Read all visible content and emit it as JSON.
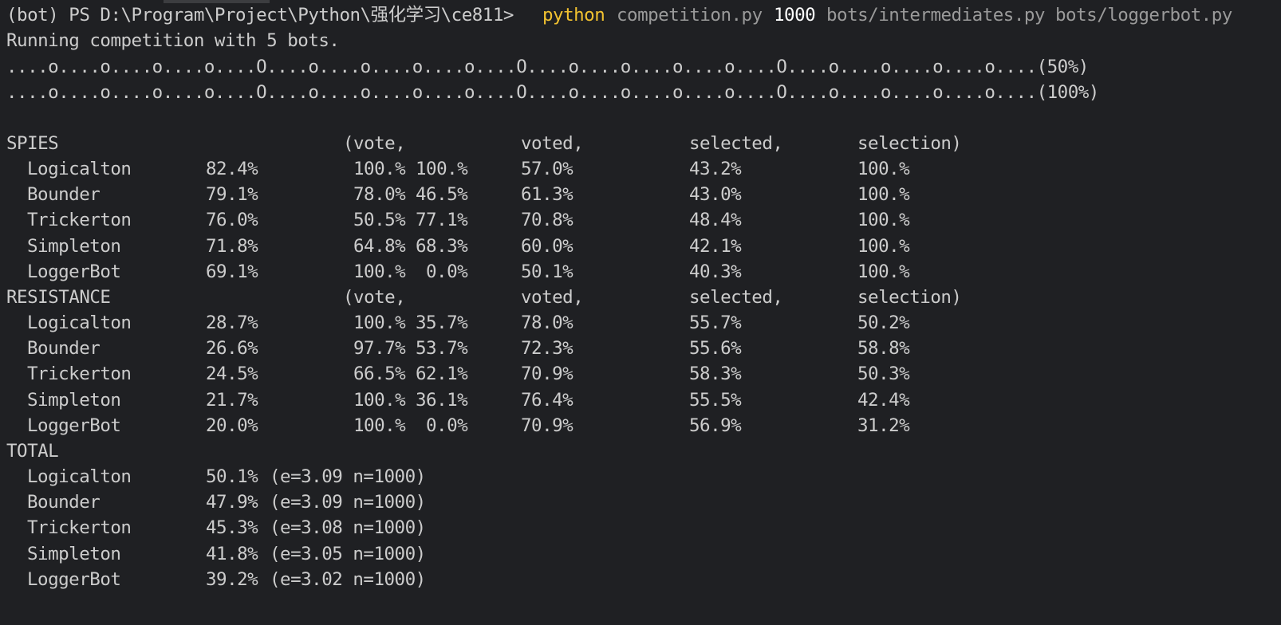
{
  "colors": {
    "background": "#1f2023",
    "text": "#cccccc",
    "command": "#f2c230",
    "argument": "#9a9a9a",
    "number": "#ffffff"
  },
  "prompt": {
    "text": "(bot) PS D:\\Program\\Project\\Python\\强化学习\\ce811>",
    "command": "python",
    "script": "competition.py",
    "games": "1000",
    "bots": "bots/intermediates.py bots/loggerbot.py"
  },
  "status": "Running competition with 5 bots.",
  "progress": [
    "....o....o....o....o....O....o....o....o....o....O....o....o....o....o....O....o....o....o....o....(50%)",
    "....o....o....o....o....O....o....o....o....o....O....o....o....o....o....O....o....o....o....o....(100%)"
  ],
  "headers": {
    "vote": "(vote,",
    "voted": "voted,",
    "selected": "selected,",
    "selection": "selection)"
  },
  "spies": {
    "title": "SPIES",
    "rows": [
      {
        "name": "Logicalton",
        "win": "82.4%",
        "vote1": "100.%",
        "vote2": "100.%",
        "voted": "57.0%",
        "selected": "43.2%",
        "selection": "100.%"
      },
      {
        "name": "Bounder",
        "win": "79.1%",
        "vote1": "78.0%",
        "vote2": "46.5%",
        "voted": "61.3%",
        "selected": "43.0%",
        "selection": "100.%"
      },
      {
        "name": "Trickerton",
        "win": "76.0%",
        "vote1": "50.5%",
        "vote2": "77.1%",
        "voted": "70.8%",
        "selected": "48.4%",
        "selection": "100.%"
      },
      {
        "name": "Simpleton",
        "win": "71.8%",
        "vote1": "64.8%",
        "vote2": "68.3%",
        "voted": "60.0%",
        "selected": "42.1%",
        "selection": "100.%"
      },
      {
        "name": "LoggerBot",
        "win": "69.1%",
        "vote1": "100.%",
        "vote2": "0.0%",
        "voted": "50.1%",
        "selected": "40.3%",
        "selection": "100.%"
      }
    ]
  },
  "resistance": {
    "title": "RESISTANCE",
    "rows": [
      {
        "name": "Logicalton",
        "win": "28.7%",
        "vote1": "100.%",
        "vote2": "35.7%",
        "voted": "78.0%",
        "selected": "55.7%",
        "selection": "50.2%"
      },
      {
        "name": "Bounder",
        "win": "26.6%",
        "vote1": "97.7%",
        "vote2": "53.7%",
        "voted": "72.3%",
        "selected": "55.6%",
        "selection": "58.8%"
      },
      {
        "name": "Trickerton",
        "win": "24.5%",
        "vote1": "66.5%",
        "vote2": "62.1%",
        "voted": "70.9%",
        "selected": "58.3%",
        "selection": "50.3%"
      },
      {
        "name": "Simpleton",
        "win": "21.7%",
        "vote1": "100.%",
        "vote2": "36.1%",
        "voted": "76.4%",
        "selected": "55.5%",
        "selection": "42.4%"
      },
      {
        "name": "LoggerBot",
        "win": "20.0%",
        "vote1": "100.%",
        "vote2": "0.0%",
        "voted": "70.9%",
        "selected": "56.9%",
        "selection": "31.2%"
      }
    ]
  },
  "total": {
    "title": "TOTAL",
    "rows": [
      {
        "name": "Logicalton",
        "win": "50.1%",
        "stats": "(e=3.09 n=1000)"
      },
      {
        "name": "Bounder",
        "win": "47.9%",
        "stats": "(e=3.09 n=1000)"
      },
      {
        "name": "Trickerton",
        "win": "45.3%",
        "stats": "(e=3.08 n=1000)"
      },
      {
        "name": "Simpleton",
        "win": "41.8%",
        "stats": "(e=3.05 n=1000)"
      },
      {
        "name": "LoggerBot",
        "win": "39.2%",
        "stats": "(e=3.02 n=1000)"
      }
    ]
  }
}
